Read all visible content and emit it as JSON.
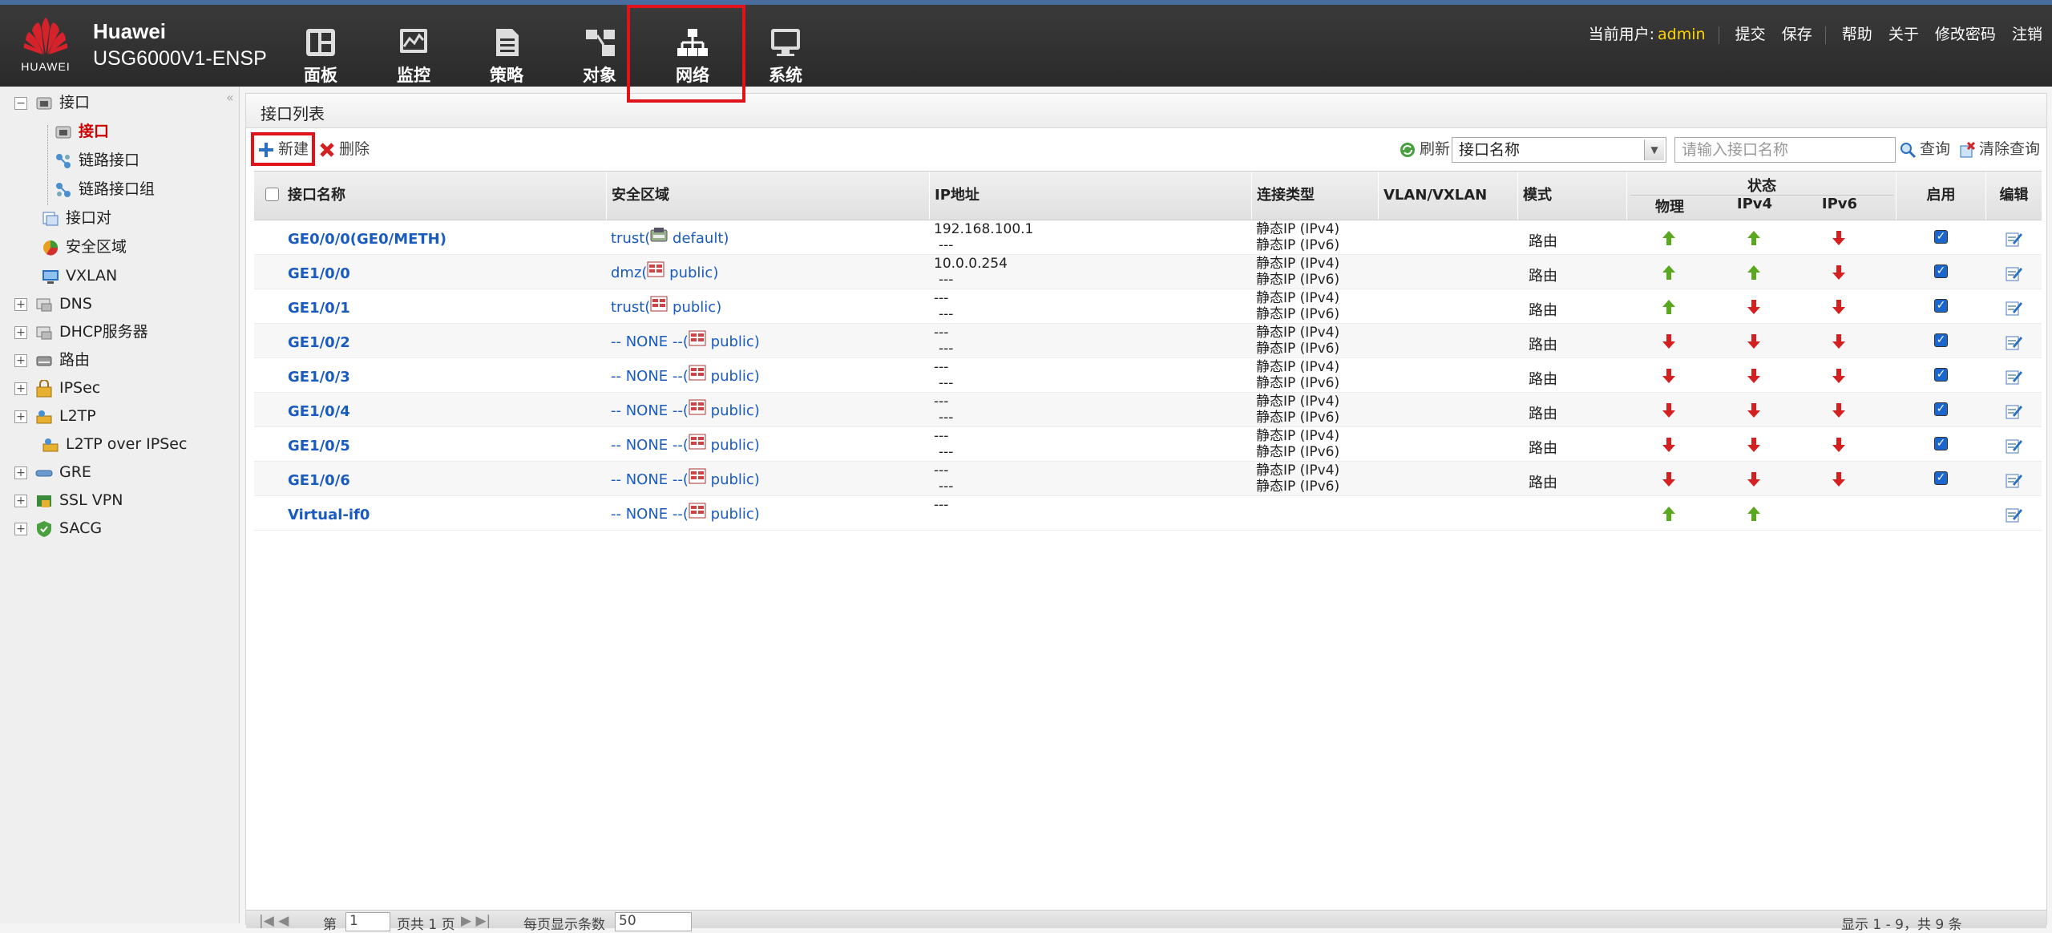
{
  "header": {
    "logo_text": "HUAWEI",
    "brand": "Huawei",
    "model": "USG6000V1-ENSP",
    "nav": [
      {
        "label": "面板",
        "icon": "dashboard-icon"
      },
      {
        "label": "监控",
        "icon": "monitor-icon"
      },
      {
        "label": "策略",
        "icon": "policy-icon"
      },
      {
        "label": "对象",
        "icon": "object-icon"
      },
      {
        "label": "网络",
        "icon": "network-icon",
        "active": true
      },
      {
        "label": "系统",
        "icon": "system-icon"
      }
    ],
    "user_label": "当前用户:",
    "user": "admin",
    "links": [
      "提交",
      "保存",
      "帮助",
      "关于",
      "修改密码",
      "注销"
    ]
  },
  "sidebar": {
    "items": [
      {
        "label": "接口"
      },
      {
        "label": "接口"
      },
      {
        "label": "链路接口"
      },
      {
        "label": "链路接口组"
      },
      {
        "label": "接口对"
      },
      {
        "label": "安全区域"
      },
      {
        "label": "VXLAN"
      },
      {
        "label": "DNS"
      },
      {
        "label": "DHCP服务器"
      },
      {
        "label": "路由"
      },
      {
        "label": "IPSec"
      },
      {
        "label": "L2TP"
      },
      {
        "label": "L2TP over IPSec"
      },
      {
        "label": "GRE"
      },
      {
        "label": "SSL VPN"
      },
      {
        "label": "SACG"
      }
    ]
  },
  "panel": {
    "title": "接口列表",
    "new_label": "新建",
    "delete_label": "删除",
    "refresh_label": "刷新",
    "filter_select": "接口名称",
    "search_placeholder": "请输入接口名称",
    "query_label": "查询",
    "clear_label": "清除查询"
  },
  "table": {
    "headers": {
      "name": "接口名称",
      "zone": "安全区域",
      "ip": "IP地址",
      "conn": "连接类型",
      "vlan": "VLAN/VXLAN",
      "mode": "模式",
      "state": "状态",
      "phys": "物理",
      "ipv4": "IPv4",
      "ipv6": "IPv6",
      "enable": "启用",
      "edit": "编辑"
    },
    "rows": [
      {
        "name": "GE0/0/0(GE0/METH)",
        "zone_prefix": "trust(",
        "zone_suffix": " default)",
        "zone_icon": "zone-default-icon",
        "ip1": "192.168.100.1",
        "ip2": "---",
        "c1": "静态IP (IPv4)",
        "c2": "静态IP (IPv6)",
        "mode": "路由",
        "phys": "up",
        "ipv4": "up",
        "ipv6": "down",
        "enabled": true
      },
      {
        "name": "GE1/0/0",
        "zone_prefix": "dmz(",
        "zone_suffix": " public)",
        "zone_icon": "zone-public-icon",
        "ip1": "10.0.0.254",
        "ip2": "---",
        "c1": "静态IP (IPv4)",
        "c2": "静态IP (IPv6)",
        "mode": "路由",
        "phys": "up",
        "ipv4": "up",
        "ipv6": "down",
        "enabled": true
      },
      {
        "name": "GE1/0/1",
        "zone_prefix": "trust(",
        "zone_suffix": " public)",
        "zone_icon": "zone-public-icon",
        "ip1": "---",
        "ip2": "---",
        "c1": "静态IP (IPv4)",
        "c2": "静态IP (IPv6)",
        "mode": "路由",
        "phys": "up",
        "ipv4": "down",
        "ipv6": "down",
        "enabled": true
      },
      {
        "name": "GE1/0/2",
        "zone_prefix": "-- NONE --(",
        "zone_suffix": " public)",
        "zone_icon": "zone-public-icon",
        "ip1": "---",
        "ip2": "---",
        "c1": "静态IP (IPv4)",
        "c2": "静态IP (IPv6)",
        "mode": "路由",
        "phys": "down",
        "ipv4": "down",
        "ipv6": "down",
        "enabled": true
      },
      {
        "name": "GE1/0/3",
        "zone_prefix": "-- NONE --(",
        "zone_suffix": " public)",
        "zone_icon": "zone-public-icon",
        "ip1": "---",
        "ip2": "---",
        "c1": "静态IP (IPv4)",
        "c2": "静态IP (IPv6)",
        "mode": "路由",
        "phys": "down",
        "ipv4": "down",
        "ipv6": "down",
        "enabled": true
      },
      {
        "name": "GE1/0/4",
        "zone_prefix": "-- NONE --(",
        "zone_suffix": " public)",
        "zone_icon": "zone-public-icon",
        "ip1": "---",
        "ip2": "---",
        "c1": "静态IP (IPv4)",
        "c2": "静态IP (IPv6)",
        "mode": "路由",
        "phys": "down",
        "ipv4": "down",
        "ipv6": "down",
        "enabled": true
      },
      {
        "name": "GE1/0/5",
        "zone_prefix": "-- NONE --(",
        "zone_suffix": " public)",
        "zone_icon": "zone-public-icon",
        "ip1": "---",
        "ip2": "---",
        "c1": "静态IP (IPv4)",
        "c2": "静态IP (IPv6)",
        "mode": "路由",
        "phys": "down",
        "ipv4": "down",
        "ipv6": "down",
        "enabled": true
      },
      {
        "name": "GE1/0/6",
        "zone_prefix": "-- NONE --(",
        "zone_suffix": " public)",
        "zone_icon": "zone-public-icon",
        "ip1": "---",
        "ip2": "---",
        "c1": "静态IP (IPv4)",
        "c2": "静态IP (IPv6)",
        "mode": "路由",
        "phys": "down",
        "ipv4": "down",
        "ipv6": "down",
        "enabled": true
      },
      {
        "name": "Virtual-if0",
        "zone_prefix": "-- NONE --(",
        "zone_suffix": " public)",
        "zone_icon": "zone-public-icon",
        "ip1": "---",
        "ip2": "",
        "c1": "",
        "c2": "",
        "mode": "",
        "phys": "up",
        "ipv4": "up",
        "ipv6": "",
        "enabled": null
      }
    ]
  },
  "pager": {
    "page_prefix": "第",
    "page": "1",
    "page_suffix": "页共 1 页",
    "per_page_label": "每页显示条数",
    "per_page": "50",
    "summary": "显示 1 - 9，共 9 条"
  },
  "colors": {
    "up": "#5aa81e",
    "down": "#d42020",
    "link": "#1a5bbf",
    "highlight": "#e0121a",
    "brand_red": "#d6222a"
  }
}
